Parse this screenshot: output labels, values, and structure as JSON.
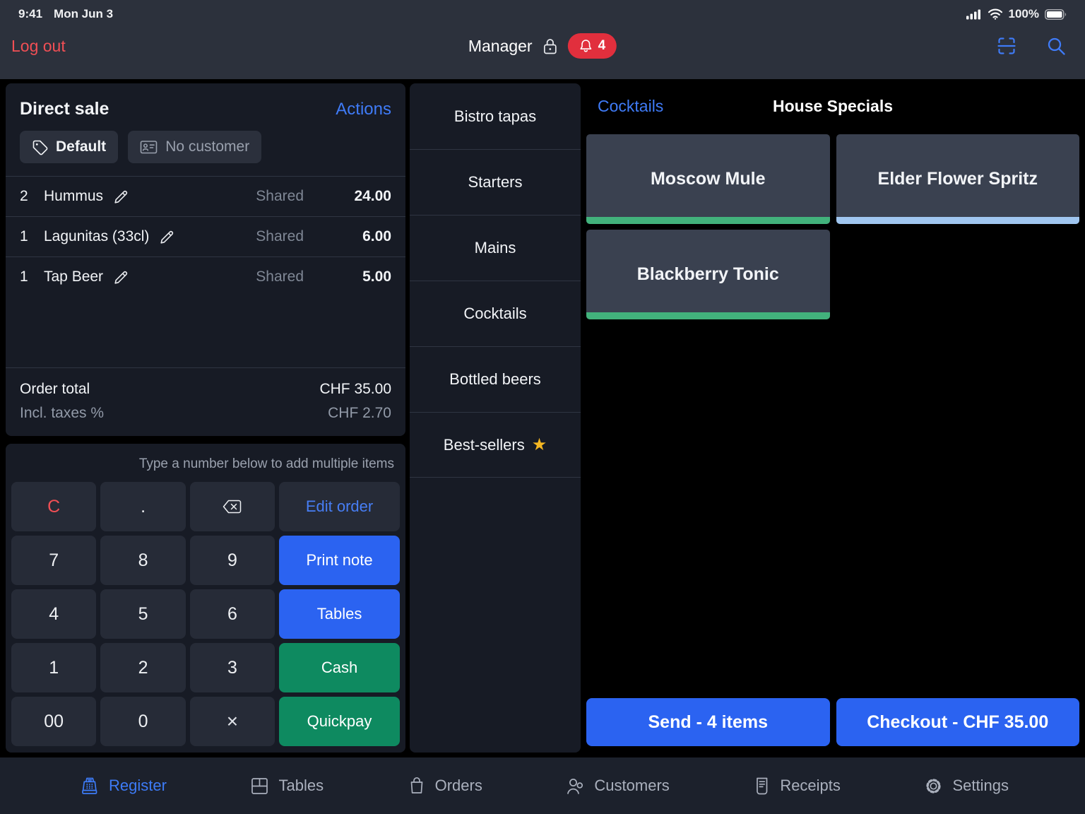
{
  "status_bar": {
    "time": "9:41",
    "date": "Mon Jun 3",
    "battery_pct": "100%"
  },
  "header": {
    "logout_label": "Log out",
    "user_label": "Manager",
    "notification_count": "4"
  },
  "order_panel": {
    "title": "Direct sale",
    "actions_label": "Actions",
    "chips": [
      {
        "label": "Default",
        "icon": "tag"
      },
      {
        "label": "No customer",
        "icon": "id-card"
      }
    ],
    "items": [
      {
        "qty": "2",
        "name": "Hummus",
        "tag": "Shared",
        "price": "24.00"
      },
      {
        "qty": "1",
        "name": "Lagunitas (33cl)",
        "tag": "Shared",
        "price": "6.00"
      },
      {
        "qty": "1",
        "name": "Tap Beer",
        "tag": "Shared",
        "price": "5.00"
      }
    ],
    "total_label": "Order total",
    "total_value": "CHF 35.00",
    "taxes_label": "Incl. taxes %",
    "taxes_value": "CHF 2.70"
  },
  "keypad": {
    "hint": "Type a number below to add multiple items",
    "clear": "C",
    "dot": ".",
    "edit": "Edit order",
    "print": "Print note",
    "tables": "Tables",
    "cash": "Cash",
    "quickpay": "Quickpay",
    "multiply": "×",
    "digits": [
      "7",
      "8",
      "9",
      "4",
      "5",
      "6",
      "1",
      "2",
      "3",
      "00",
      "0"
    ]
  },
  "categories": {
    "star_glyph": "★",
    "items": [
      {
        "label": "Bistro tapas"
      },
      {
        "label": "Starters"
      },
      {
        "label": "Mains"
      },
      {
        "label": "Cocktails"
      },
      {
        "label": "Bottled beers"
      },
      {
        "label": "Best-sellers"
      }
    ]
  },
  "products": {
    "parent_tab": "Cocktails",
    "section_title": "House Specials",
    "tiles": [
      {
        "name": "Moscow Mule",
        "accent": "#42b27c"
      },
      {
        "name": "Elder Flower Spritz",
        "accent": "#a0c6f0"
      },
      {
        "name": "Blackberry Tonic",
        "accent": "#42b27c"
      }
    ],
    "send_label": "Send - 4 items",
    "checkout_label": "Checkout - CHF 35.00"
  },
  "bottom_nav": {
    "items": [
      {
        "label": "Register",
        "active": true
      },
      {
        "label": "Tables",
        "active": false
      },
      {
        "label": "Orders",
        "active": false
      },
      {
        "label": "Customers",
        "active": false
      },
      {
        "label": "Receipts",
        "active": false
      },
      {
        "label": "Settings",
        "active": false
      }
    ]
  },
  "colors": {
    "accent_blue": "#2b63f1",
    "link_blue": "#3f7bf7",
    "action_green": "#0e8a60",
    "tile_green": "#42b27c",
    "tile_light_blue": "#a0c6f0",
    "badge_red": "#e12f3d",
    "logout_red": "#f14f55"
  }
}
